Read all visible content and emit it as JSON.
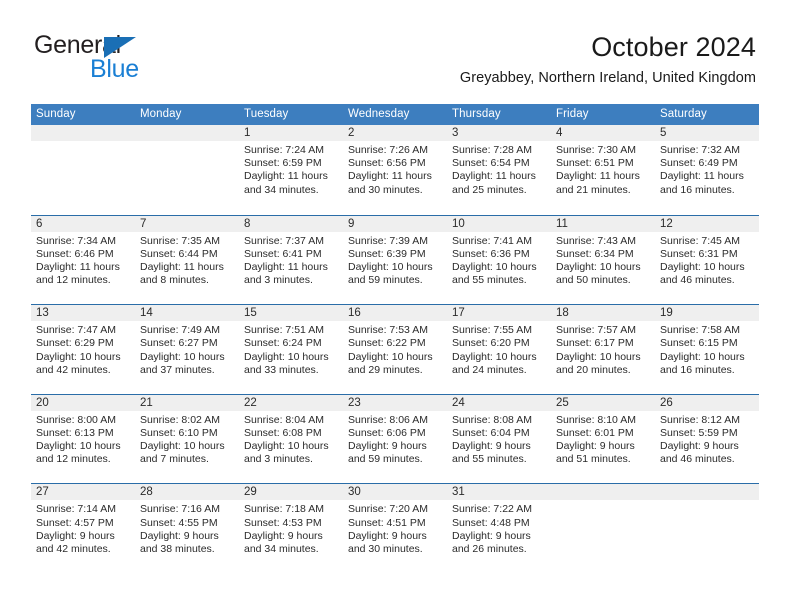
{
  "brand": {
    "name_top": "General",
    "name_bottom": "Blue",
    "triangle_color": "#1a6fb5",
    "blue_color": "#1a7fd4"
  },
  "header": {
    "title": "October 2024",
    "location": "Greyabbey, Northern Ireland, United Kingdom"
  },
  "theme": {
    "header_blue": "#3d7ebf",
    "row_rule_blue": "#2a6da8",
    "date_band_gray": "#efefef"
  },
  "weekday_headers": [
    "Sunday",
    "Monday",
    "Tuesday",
    "Wednesday",
    "Thursday",
    "Friday",
    "Saturday"
  ],
  "labels": {
    "sunrise_prefix": "Sunrise:",
    "sunset_prefix": "Sunset:",
    "daylight_prefix": "Daylight:"
  },
  "weeks": [
    [
      {
        "day": "",
        "sunrise": "",
        "sunset": "",
        "daylight_line1": "",
        "daylight_line2": "",
        "empty": true
      },
      {
        "day": "",
        "sunrise": "",
        "sunset": "",
        "daylight_line1": "",
        "daylight_line2": "",
        "empty": true
      },
      {
        "day": "1",
        "sunrise": "Sunrise: 7:24 AM",
        "sunset": "Sunset: 6:59 PM",
        "daylight_line1": "Daylight: 11 hours",
        "daylight_line2": "and 34 minutes."
      },
      {
        "day": "2",
        "sunrise": "Sunrise: 7:26 AM",
        "sunset": "Sunset: 6:56 PM",
        "daylight_line1": "Daylight: 11 hours",
        "daylight_line2": "and 30 minutes."
      },
      {
        "day": "3",
        "sunrise": "Sunrise: 7:28 AM",
        "sunset": "Sunset: 6:54 PM",
        "daylight_line1": "Daylight: 11 hours",
        "daylight_line2": "and 25 minutes."
      },
      {
        "day": "4",
        "sunrise": "Sunrise: 7:30 AM",
        "sunset": "Sunset: 6:51 PM",
        "daylight_line1": "Daylight: 11 hours",
        "daylight_line2": "and 21 minutes."
      },
      {
        "day": "5",
        "sunrise": "Sunrise: 7:32 AM",
        "sunset": "Sunset: 6:49 PM",
        "daylight_line1": "Daylight: 11 hours",
        "daylight_line2": "and 16 minutes."
      }
    ],
    [
      {
        "day": "6",
        "sunrise": "Sunrise: 7:34 AM",
        "sunset": "Sunset: 6:46 PM",
        "daylight_line1": "Daylight: 11 hours",
        "daylight_line2": "and 12 minutes."
      },
      {
        "day": "7",
        "sunrise": "Sunrise: 7:35 AM",
        "sunset": "Sunset: 6:44 PM",
        "daylight_line1": "Daylight: 11 hours",
        "daylight_line2": "and 8 minutes."
      },
      {
        "day": "8",
        "sunrise": "Sunrise: 7:37 AM",
        "sunset": "Sunset: 6:41 PM",
        "daylight_line1": "Daylight: 11 hours",
        "daylight_line2": "and 3 minutes."
      },
      {
        "day": "9",
        "sunrise": "Sunrise: 7:39 AM",
        "sunset": "Sunset: 6:39 PM",
        "daylight_line1": "Daylight: 10 hours",
        "daylight_line2": "and 59 minutes."
      },
      {
        "day": "10",
        "sunrise": "Sunrise: 7:41 AM",
        "sunset": "Sunset: 6:36 PM",
        "daylight_line1": "Daylight: 10 hours",
        "daylight_line2": "and 55 minutes."
      },
      {
        "day": "11",
        "sunrise": "Sunrise: 7:43 AM",
        "sunset": "Sunset: 6:34 PM",
        "daylight_line1": "Daylight: 10 hours",
        "daylight_line2": "and 50 minutes."
      },
      {
        "day": "12",
        "sunrise": "Sunrise: 7:45 AM",
        "sunset": "Sunset: 6:31 PM",
        "daylight_line1": "Daylight: 10 hours",
        "daylight_line2": "and 46 minutes."
      }
    ],
    [
      {
        "day": "13",
        "sunrise": "Sunrise: 7:47 AM",
        "sunset": "Sunset: 6:29 PM",
        "daylight_line1": "Daylight: 10 hours",
        "daylight_line2": "and 42 minutes."
      },
      {
        "day": "14",
        "sunrise": "Sunrise: 7:49 AM",
        "sunset": "Sunset: 6:27 PM",
        "daylight_line1": "Daylight: 10 hours",
        "daylight_line2": "and 37 minutes."
      },
      {
        "day": "15",
        "sunrise": "Sunrise: 7:51 AM",
        "sunset": "Sunset: 6:24 PM",
        "daylight_line1": "Daylight: 10 hours",
        "daylight_line2": "and 33 minutes."
      },
      {
        "day": "16",
        "sunrise": "Sunrise: 7:53 AM",
        "sunset": "Sunset: 6:22 PM",
        "daylight_line1": "Daylight: 10 hours",
        "daylight_line2": "and 29 minutes."
      },
      {
        "day": "17",
        "sunrise": "Sunrise: 7:55 AM",
        "sunset": "Sunset: 6:20 PM",
        "daylight_line1": "Daylight: 10 hours",
        "daylight_line2": "and 24 minutes."
      },
      {
        "day": "18",
        "sunrise": "Sunrise: 7:57 AM",
        "sunset": "Sunset: 6:17 PM",
        "daylight_line1": "Daylight: 10 hours",
        "daylight_line2": "and 20 minutes."
      },
      {
        "day": "19",
        "sunrise": "Sunrise: 7:58 AM",
        "sunset": "Sunset: 6:15 PM",
        "daylight_line1": "Daylight: 10 hours",
        "daylight_line2": "and 16 minutes."
      }
    ],
    [
      {
        "day": "20",
        "sunrise": "Sunrise: 8:00 AM",
        "sunset": "Sunset: 6:13 PM",
        "daylight_line1": "Daylight: 10 hours",
        "daylight_line2": "and 12 minutes."
      },
      {
        "day": "21",
        "sunrise": "Sunrise: 8:02 AM",
        "sunset": "Sunset: 6:10 PM",
        "daylight_line1": "Daylight: 10 hours",
        "daylight_line2": "and 7 minutes."
      },
      {
        "day": "22",
        "sunrise": "Sunrise: 8:04 AM",
        "sunset": "Sunset: 6:08 PM",
        "daylight_line1": "Daylight: 10 hours",
        "daylight_line2": "and 3 minutes."
      },
      {
        "day": "23",
        "sunrise": "Sunrise: 8:06 AM",
        "sunset": "Sunset: 6:06 PM",
        "daylight_line1": "Daylight: 9 hours",
        "daylight_line2": "and 59 minutes."
      },
      {
        "day": "24",
        "sunrise": "Sunrise: 8:08 AM",
        "sunset": "Sunset: 6:04 PM",
        "daylight_line1": "Daylight: 9 hours",
        "daylight_line2": "and 55 minutes."
      },
      {
        "day": "25",
        "sunrise": "Sunrise: 8:10 AM",
        "sunset": "Sunset: 6:01 PM",
        "daylight_line1": "Daylight: 9 hours",
        "daylight_line2": "and 51 minutes."
      },
      {
        "day": "26",
        "sunrise": "Sunrise: 8:12 AM",
        "sunset": "Sunset: 5:59 PM",
        "daylight_line1": "Daylight: 9 hours",
        "daylight_line2": "and 46 minutes."
      }
    ],
    [
      {
        "day": "27",
        "sunrise": "Sunrise: 7:14 AM",
        "sunset": "Sunset: 4:57 PM",
        "daylight_line1": "Daylight: 9 hours",
        "daylight_line2": "and 42 minutes."
      },
      {
        "day": "28",
        "sunrise": "Sunrise: 7:16 AM",
        "sunset": "Sunset: 4:55 PM",
        "daylight_line1": "Daylight: 9 hours",
        "daylight_line2": "and 38 minutes."
      },
      {
        "day": "29",
        "sunrise": "Sunrise: 7:18 AM",
        "sunset": "Sunset: 4:53 PM",
        "daylight_line1": "Daylight: 9 hours",
        "daylight_line2": "and 34 minutes."
      },
      {
        "day": "30",
        "sunrise": "Sunrise: 7:20 AM",
        "sunset": "Sunset: 4:51 PM",
        "daylight_line1": "Daylight: 9 hours",
        "daylight_line2": "and 30 minutes."
      },
      {
        "day": "31",
        "sunrise": "Sunrise: 7:22 AM",
        "sunset": "Sunset: 4:48 PM",
        "daylight_line1": "Daylight: 9 hours",
        "daylight_line2": "and 26 minutes."
      },
      {
        "day": "",
        "sunrise": "",
        "sunset": "",
        "daylight_line1": "",
        "daylight_line2": "",
        "empty": true
      },
      {
        "day": "",
        "sunrise": "",
        "sunset": "",
        "daylight_line1": "",
        "daylight_line2": "",
        "empty": true
      }
    ]
  ]
}
